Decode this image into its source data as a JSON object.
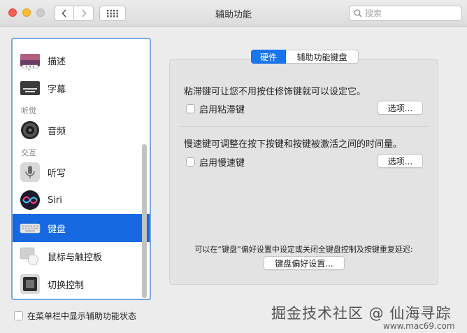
{
  "window": {
    "title": "辅助功能"
  },
  "toolbar": {
    "search_placeholder": "搜索"
  },
  "sidebar": {
    "items": [
      {
        "label": "描述",
        "icon": "description-icon"
      },
      {
        "label": "字幕",
        "icon": "captions-icon"
      },
      {
        "label": "音频",
        "icon": "speaker-icon"
      },
      {
        "label": "听写",
        "icon": "microphone-icon"
      },
      {
        "label": "Siri",
        "icon": "siri-icon"
      },
      {
        "label": "键盘",
        "icon": "keyboard-icon",
        "selected": true
      },
      {
        "label": "鼠标与触控板",
        "icon": "mouse-trackpad-icon"
      },
      {
        "label": "切换控制",
        "icon": "switch-control-icon"
      }
    ],
    "headers": {
      "hearing": "听觉",
      "interaction": "交互"
    }
  },
  "footer": {
    "show_status_label": "在菜单栏中显示辅助功能状态"
  },
  "tabs": [
    {
      "label": "硬件",
      "active": true
    },
    {
      "label": "辅助功能键盘",
      "active": false
    }
  ],
  "hardware": {
    "sticky_desc": "粘滞键可让您不用按住修饰键就可以设定它。",
    "sticky_check": "启用粘滞键",
    "sticky_options": "选项...",
    "slow_desc": "慢速键可调整在按下按键和按键被激活之间的时间量。",
    "slow_check": "启用慢速键",
    "slow_options": "选项...",
    "note": "可以在“键盘”偏好设置中设定或关闭全键盘控制及按键重复延迟:",
    "prefs_button": "键盘偏好设置..."
  },
  "watermark": {
    "text": "掘金技术社区 @ 仙海寻踪",
    "sub": "www.mac69.com"
  },
  "colors": {
    "accent": "#1669e0",
    "selection_border": "#7aa7e0"
  }
}
